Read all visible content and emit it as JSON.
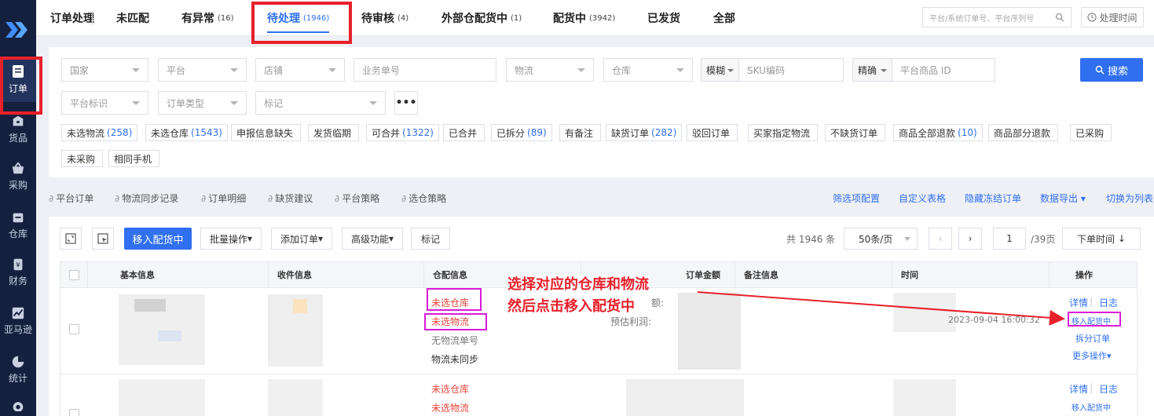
{
  "sidebar": {
    "items": [
      {
        "label": "订单",
        "icon": "order-icon"
      },
      {
        "label": "货品",
        "icon": "goods-icon"
      },
      {
        "label": "采购",
        "icon": "basket-icon"
      },
      {
        "label": "仓库",
        "icon": "warehouse-icon"
      },
      {
        "label": "财务",
        "icon": "finance-icon"
      },
      {
        "label": "亚马逊",
        "icon": "chart-line-icon"
      },
      {
        "label": "统计",
        "icon": "pie-chart-icon"
      }
    ]
  },
  "topbar": {
    "section_title": "订单处理",
    "tabs": [
      {
        "label": "未匹配",
        "count": ""
      },
      {
        "label": "有异常",
        "count": "(16)"
      },
      {
        "label": "待处理",
        "count": "(1946)"
      },
      {
        "label": "待审核",
        "count": "(4)"
      },
      {
        "label": "外部仓配货中",
        "count": "(1)"
      },
      {
        "label": "配货中",
        "count": "(3942)"
      },
      {
        "label": "已发货",
        "count": ""
      },
      {
        "label": "全部",
        "count": ""
      }
    ],
    "search_placeholder": "平台/系统订单号、平台序列号",
    "time_button": "处理时间"
  },
  "filters": {
    "country": "国家",
    "platform": "平台",
    "shop": "店铺",
    "business_no": "业务单号",
    "logistics": "物流",
    "warehouse": "仓库",
    "fuzzy": "模糊",
    "sku": "SKU编码",
    "exact": "精确",
    "platform_product_id": "平台商品 ID",
    "search_button": "搜索",
    "platform_tag": "平台标识",
    "order_type": "订单类型",
    "mark": "标记",
    "more": "•••"
  },
  "quick_tags": [
    {
      "label": "未选物流",
      "count": "(258)"
    },
    {
      "label": "未选仓库",
      "count": "(1543)"
    },
    {
      "label": "申报信息缺失",
      "count": ""
    },
    {
      "label": "发货临期",
      "count": ""
    },
    {
      "label": "可合并",
      "count": "(1322)"
    },
    {
      "label": "已合并",
      "count": ""
    },
    {
      "label": "已拆分",
      "count": "(89)"
    },
    {
      "label": "有备注",
      "count": ""
    },
    {
      "label": "缺货订单",
      "count": "(282)"
    },
    {
      "label": "驳回订单",
      "count": ""
    },
    {
      "label": "买家指定物流",
      "count": ""
    },
    {
      "label": "不缺货订单",
      "count": ""
    },
    {
      "label": "商品全部退款",
      "count": "(10)"
    },
    {
      "label": "商品部分退款",
      "count": ""
    },
    {
      "label": "已采购",
      "count": ""
    },
    {
      "label": "未采购",
      "count": ""
    },
    {
      "label": "相同手机",
      "count": ""
    }
  ],
  "links_left": [
    "平台订单",
    "物流同步记录",
    "订单明细",
    "缺货建议",
    "平台策略",
    "选仓策略"
  ],
  "links_right": [
    "筛选项配置",
    "自定义表格",
    "隐藏冻结订单",
    "数据导出",
    "切换为列表"
  ],
  "toolbar": {
    "move_button": "移入配货中",
    "batch": "批量操作",
    "add_order": "添加订单",
    "advanced": "高级功能",
    "mark": "标记",
    "total": "共 1946 条",
    "page_size": "50条/页",
    "page_current": "1",
    "page_total": "/39页",
    "sort": "下单时间"
  },
  "table": {
    "headers": [
      "基本信息",
      "收件信息",
      "仓配信息",
      "订单金额",
      "备注信息",
      "时间",
      "操作"
    ],
    "rows": [
      {
        "warehouse": "未选仓库",
        "logistics": "未选物流",
        "tracking": "无物流单号",
        "sync": "物流未同步",
        "amount_frag1": "额:",
        "amount_frag2": "预估利润:",
        "time_frag": "2023-09-04 16:00:32",
        "ops": {
          "detail": "详情",
          "log": "日志",
          "move": "移入配货中",
          "split": "拆分订单",
          "more": "更多操作"
        }
      },
      {
        "warehouse": "未选仓库",
        "logistics": "未选物流",
        "ops": {
          "detail": "详情",
          "log": "日志",
          "move": "移入配货中"
        }
      }
    ]
  },
  "annotation": {
    "line1": "选择对应的仓库和物流",
    "line2": "然后点击移入配货中"
  },
  "colors": {
    "primary": "#2f6ff0",
    "sidebar": "#14203d",
    "highlight_red": "#e8202b",
    "highlight_magenta": "#d81bd8",
    "warn_text": "#e8453c"
  }
}
